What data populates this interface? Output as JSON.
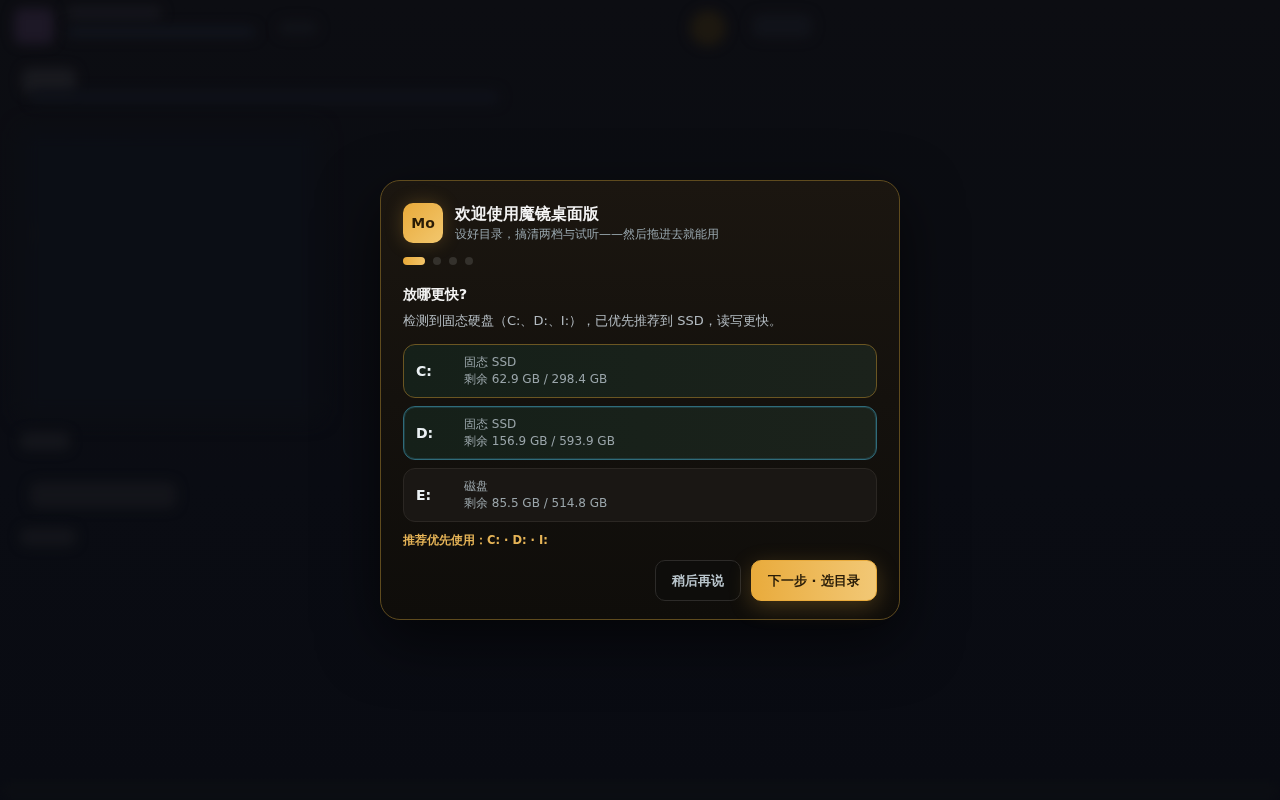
{
  "dialog": {
    "logo": "Mo",
    "title": "欢迎使用魔镜桌面版",
    "subtitle": "设好目录，搞清两档与试听——然后拖进去就能用",
    "steps": [
      {
        "selected": true
      },
      {
        "selected": false
      },
      {
        "selected": false
      },
      {
        "selected": false
      }
    ],
    "heading": "放哪更快?",
    "description": "检测到固态硬盘（C:、D:、I:），已优先推荐到 SSD，读写更快。",
    "drives": [
      {
        "letter": "C:",
        "type": "固态 SSD",
        "free": "剩余 62.9 GB / 298.4 GB",
        "recommended": true,
        "selected": false
      },
      {
        "letter": "D:",
        "type": "固态 SSD",
        "free": "剩余 156.9 GB / 593.9 GB",
        "recommended": true,
        "selected": true
      },
      {
        "letter": "E:",
        "type": "磁盘",
        "free": "剩余 85.5 GB / 514.8 GB",
        "recommended": false,
        "selected": false
      }
    ],
    "recommendation": "推荐优先使用：C: · D: · I:",
    "buttons": [
      {
        "label": "稍后再说",
        "kind": "secondary"
      },
      {
        "label": "下一步 · 选目录",
        "kind": "primary"
      }
    ]
  }
}
